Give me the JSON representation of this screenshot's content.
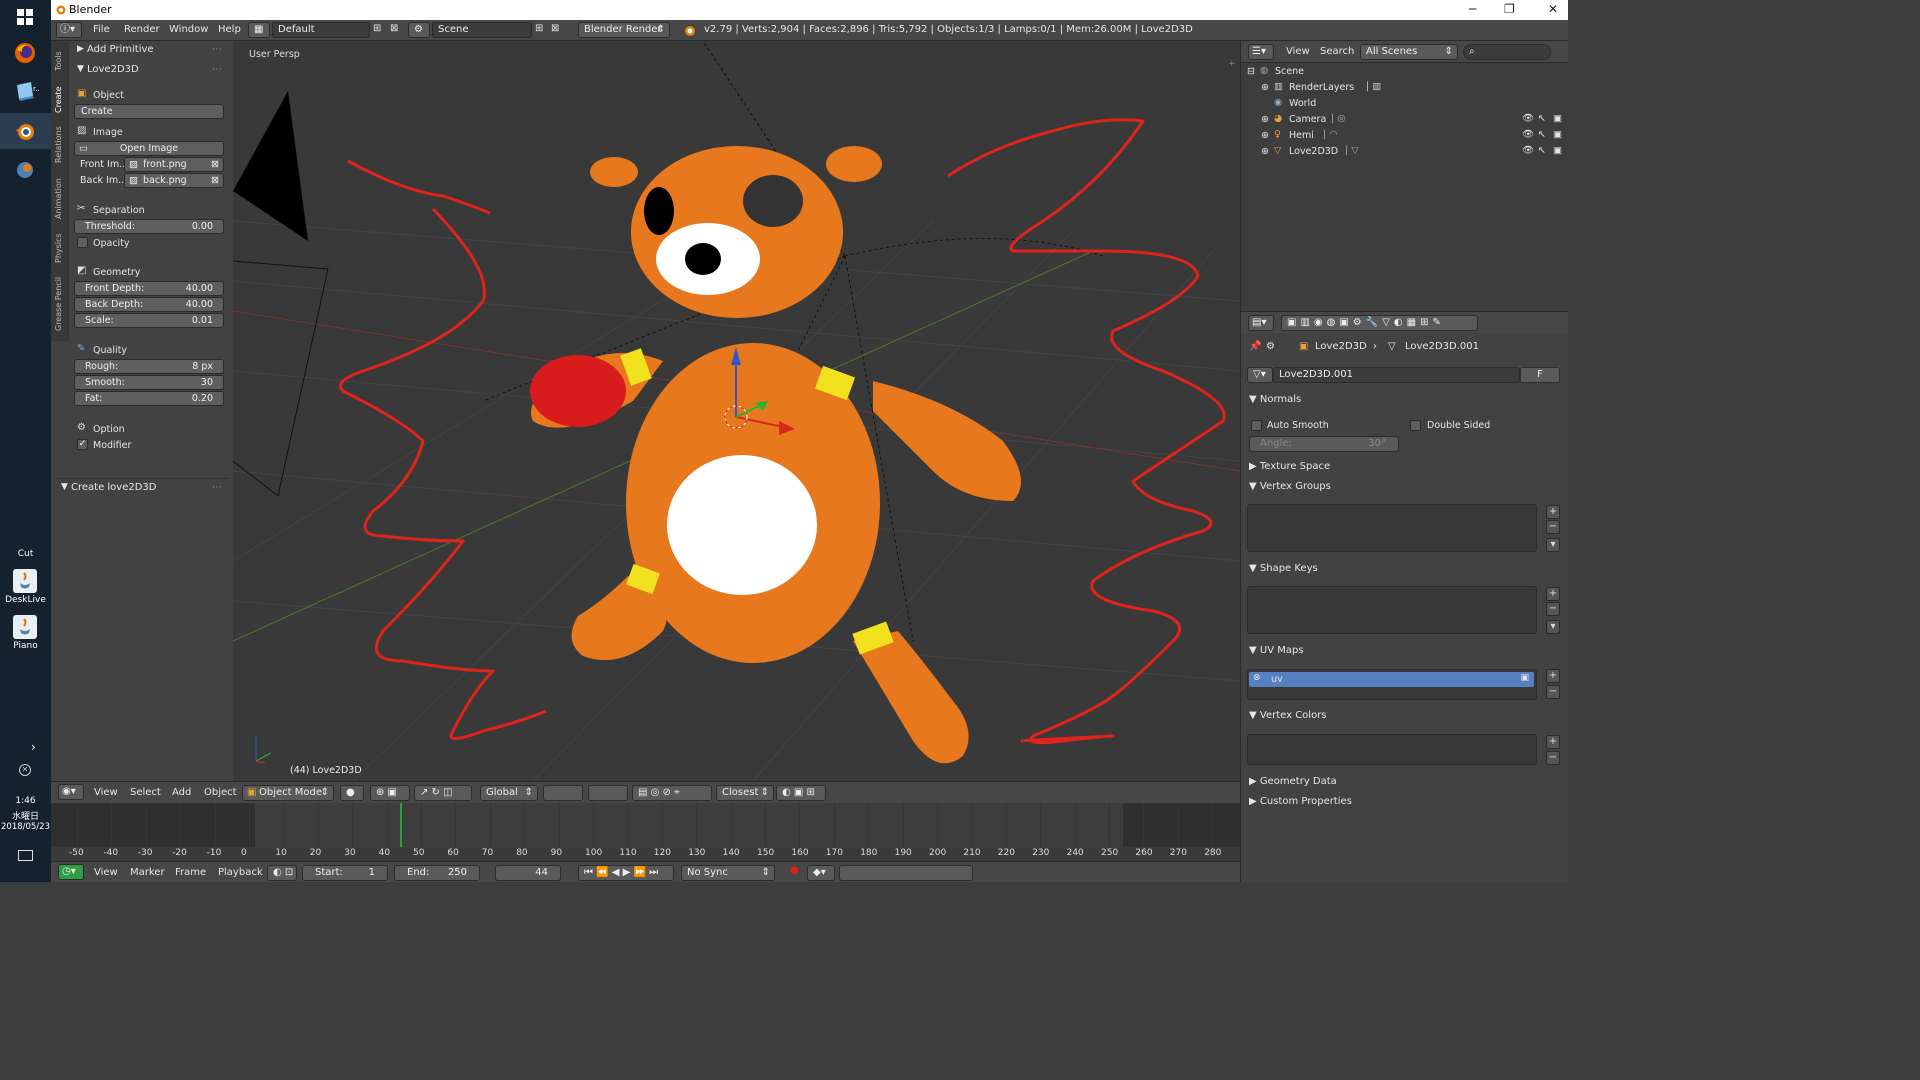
{
  "window": {
    "title": "Blender",
    "minimize": "─",
    "maximize": "❐",
    "close": "✕"
  },
  "taskbar": {
    "items": [
      {
        "name": "firefox"
      },
      {
        "name": "blender"
      }
    ],
    "cut_label": "Cut",
    "desklive_label": "DeskLive",
    "piano_label": "Piano",
    "time": "1:46",
    "weekday": "水曜日",
    "date": "2018/05/23"
  },
  "info_header": {
    "menus": [
      "File",
      "Render",
      "Window",
      "Help"
    ],
    "screen_layout": "Default",
    "scene": "Scene",
    "engine": "Blender Render",
    "stats": "v2.79 | Verts:2,904 | Faces:2,896 | Tris:5,792 | Objects:1/3 | Lamps:0/1 | Mem:26.00M | Love2D3D"
  },
  "tool_shelf": {
    "tabs": [
      "Tools",
      "Create",
      "Relations",
      "Animation",
      "Physics",
      "Grease Pencil"
    ],
    "add_primitive": "Add Primitive",
    "panel_title": "Love2D3D",
    "object_label": "Object",
    "create_button": "Create",
    "image_label": "Image",
    "open_image_button": "Open Image",
    "front_image_label": "Front Im...",
    "front_image_value": "front.png",
    "back_image_label": "Back Im...",
    "back_image_value": "back.png",
    "separation_label": "Separation",
    "threshold_label": "Threshold:",
    "threshold_value": "0.00",
    "opacity_label": "Opacity",
    "geometry_label": "Geometry",
    "front_depth_label": "Front Depth:",
    "front_depth_value": "40.00",
    "back_depth_label": "Back Depth:",
    "back_depth_value": "40.00",
    "scale_label": "Scale:",
    "scale_value": "0.01",
    "quality_label": "Quality",
    "rough_label": "Rough:",
    "rough_value": "8 px",
    "smooth_label": "Smooth:",
    "smooth_value": "30",
    "fat_label": "Fat:",
    "fat_value": "0.20",
    "option_label": "Option",
    "modifier_label": "Modifier",
    "operator_panel": "Create love2D3D"
  },
  "viewport": {
    "view_name": "User Persp",
    "object_label": "(44) Love2D3D"
  },
  "view3d_header": {
    "menus": [
      "View",
      "Select",
      "Add",
      "Object"
    ],
    "mode": "Object Mode",
    "orientation": "Global",
    "snap": "Closest"
  },
  "timeline": {
    "ticks": [
      "-50",
      "-40",
      "-30",
      "-20",
      "-10",
      "0",
      "10",
      "20",
      "30",
      "40",
      "50",
      "60",
      "70",
      "80",
      "90",
      "100",
      "110",
      "120",
      "130",
      "140",
      "150",
      "160",
      "170",
      "180",
      "190",
      "200",
      "210",
      "220",
      "230",
      "240",
      "250",
      "260",
      "270",
      "280"
    ],
    "current_frame": 44,
    "menus": [
      "View",
      "Marker",
      "Frame",
      "Playback"
    ],
    "start_label": "Start:",
    "start_value": "1",
    "end_label": "End:",
    "end_value": "250",
    "frame_value": "44",
    "sync": "No Sync"
  },
  "outliner": {
    "menus": [
      "View",
      "Search"
    ],
    "filter": "All Scenes",
    "rows": [
      {
        "label": "Scene"
      },
      {
        "label": "RenderLayers"
      },
      {
        "label": "World"
      },
      {
        "label": "Camera"
      },
      {
        "label": "Hemi"
      },
      {
        "label": "Love2D3D"
      }
    ]
  },
  "properties": {
    "breadcrumb_object": "Love2D3D",
    "breadcrumb_mesh": "Love2D3D.001",
    "mesh_name": "Love2D3D.001",
    "fake_user": "F",
    "normals": "Normals",
    "auto_smooth": "Auto Smooth",
    "double_sided": "Double Sided",
    "angle_label": "Angle:",
    "angle_value": "30°",
    "texture_space": "Texture Space",
    "vertex_groups": "Vertex Groups",
    "shape_keys": "Shape Keys",
    "uv_maps": "UV Maps",
    "uv_item": "uv",
    "vertex_colors": "Vertex Colors",
    "geometry_data": "Geometry Data",
    "custom_properties": "Custom Properties"
  },
  "colors": {
    "accent_blue": "#5680c2",
    "mesh_orange": "#e8781e",
    "stroke_red": "#e0231b",
    "playhead_green": "#2ea043"
  }
}
